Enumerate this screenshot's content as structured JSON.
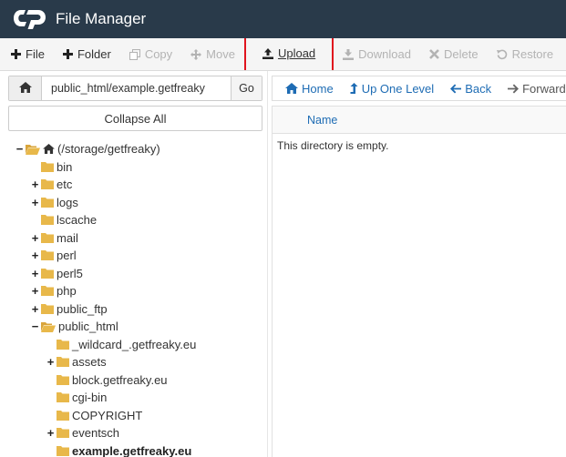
{
  "header": {
    "title": "File Manager",
    "logo": "cpanel-logo",
    "bg_color": "#293a4a"
  },
  "toolbar": {
    "items": [
      {
        "label": "File",
        "icon": "plus-icon",
        "enabled": true
      },
      {
        "label": "Folder",
        "icon": "plus-icon",
        "enabled": true
      },
      {
        "label": "Copy",
        "icon": "copy-icon",
        "enabled": false
      },
      {
        "label": "Move",
        "icon": "move-icon",
        "enabled": false
      },
      {
        "label": "Upload",
        "icon": "upload-icon",
        "enabled": true,
        "highlighted": true
      },
      {
        "label": "Download",
        "icon": "download-icon",
        "enabled": false
      },
      {
        "label": "Delete",
        "icon": "delete-x-icon",
        "enabled": false
      },
      {
        "label": "Restore",
        "icon": "restore-icon",
        "enabled": false
      }
    ],
    "highlight_color": "#e0141e"
  },
  "path_bar": {
    "value": "public_html/example.getfreaky",
    "go_label": "Go"
  },
  "collapse_label": "Collapse All",
  "tree": [
    {
      "label": "(/storage/getfreaky)",
      "toggle": "−",
      "open": true,
      "home": true
    },
    {
      "label": "bin",
      "toggle": ""
    },
    {
      "label": "etc",
      "toggle": "+"
    },
    {
      "label": "logs",
      "toggle": "+"
    },
    {
      "label": "lscache",
      "toggle": ""
    },
    {
      "label": "mail",
      "toggle": "+"
    },
    {
      "label": "perl",
      "toggle": "+"
    },
    {
      "label": "perl5",
      "toggle": "+"
    },
    {
      "label": "php",
      "toggle": "+"
    },
    {
      "label": "public_ftp",
      "toggle": "+"
    },
    {
      "label": "public_html",
      "toggle": "−",
      "open": true
    },
    {
      "label": "_wildcard_.getfreaky.eu",
      "toggle": ""
    },
    {
      "label": "assets",
      "toggle": "+"
    },
    {
      "label": "block.getfreaky.eu",
      "toggle": ""
    },
    {
      "label": "cgi-bin",
      "toggle": ""
    },
    {
      "label": "COPYRIGHT",
      "toggle": ""
    },
    {
      "label": "eventsch",
      "toggle": "+"
    },
    {
      "label": "example.getfreaky.eu",
      "toggle": "",
      "current": true
    }
  ],
  "nav": {
    "items": [
      {
        "label": "Home",
        "icon": "home-icon"
      },
      {
        "label": "Up One Level",
        "icon": "level-up-icon"
      },
      {
        "label": "Back",
        "icon": "arrow-left-icon"
      },
      {
        "label": "Forward",
        "icon": "arrow-right-icon"
      }
    ]
  },
  "list": {
    "column_name": "Name",
    "empty_message": "This directory is empty."
  },
  "colors": {
    "folder": "#e8b84a",
    "link": "#1e6cb4"
  }
}
